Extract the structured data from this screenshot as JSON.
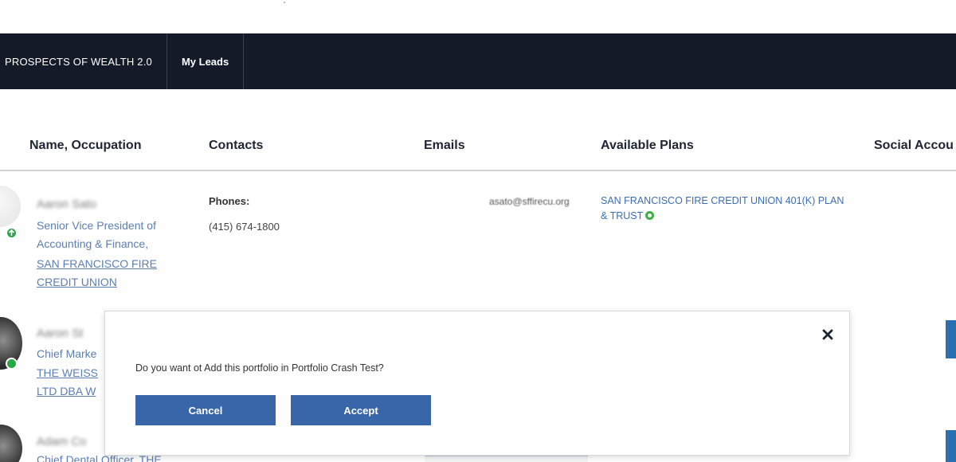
{
  "nav": {
    "brand": "PROSPECTS OF WEALTH 2.0",
    "tabs": [
      {
        "label": "My Leads"
      }
    ]
  },
  "table": {
    "headers": [
      "Name, Occupation",
      "Contacts",
      "Emails",
      "Available Plans",
      "Social Accou"
    ]
  },
  "rows": [
    {
      "name": "Aaron Sato",
      "occupation": "Senior Vice President of Accounting & Finance,",
      "company_line1": "SAN FRANCISCO FIRE",
      "company_line2": "CREDIT UNION",
      "phones_label": "Phones:",
      "phone": "(415) 674-1800",
      "email": "asato@sffirecu.org",
      "plan": "SAN FRANCISCO FIRE CREDIT UNION 401(K) PLAN & TRUST"
    },
    {
      "name": "Aaron St",
      "occupation": "Chief Marke",
      "company_line1": "THE WEISS",
      "company_line2": "LTD DBA W"
    },
    {
      "name": "Adam Co",
      "occupation": "Chief Dental Officer, THE"
    }
  ],
  "modal": {
    "message": "Do you want ot Add this portfolio in Portfolio Crash Test?",
    "cancel_label": "Cancel",
    "accept_label": "Accept"
  },
  "colors": {
    "nav_bg": "#141a28",
    "button_bg": "#3866a8",
    "link": "#5b7fb4",
    "status_green": "#27a844"
  }
}
